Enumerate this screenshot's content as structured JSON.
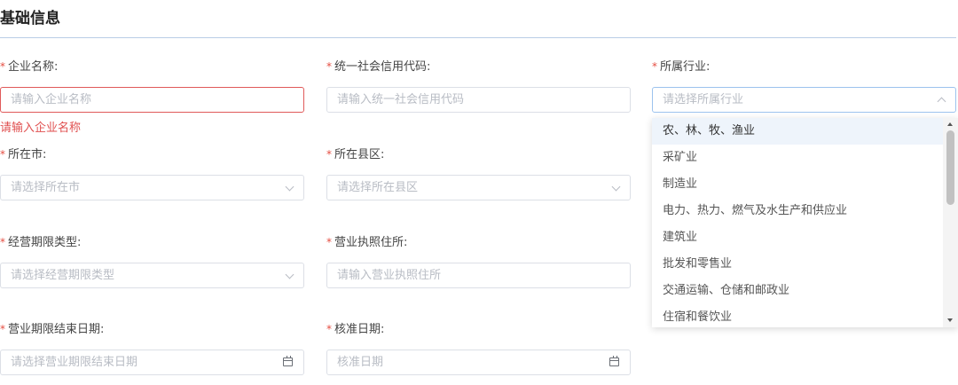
{
  "section_title": "基础信息",
  "company_name": {
    "label": "企业名称:",
    "placeholder": "请输入企业名称",
    "error": "请输入企业名称"
  },
  "credit_code": {
    "label": "统一社会信用代码:",
    "placeholder": "请输入统一社会信用代码"
  },
  "industry": {
    "label": "所属行业:",
    "placeholder": "请选择所属行业",
    "options": [
      "农、林、牧、渔业",
      "采矿业",
      "制造业",
      "电力、热力、燃气及水生产和供应业",
      "建筑业",
      "批发和零售业",
      "交通运输、仓储和邮政业",
      "住宿和餐饮业"
    ]
  },
  "city": {
    "label": "所在市:",
    "placeholder": "请选择所在市"
  },
  "county": {
    "label": "所在县区:",
    "placeholder": "请选择所在县区"
  },
  "term_type": {
    "label": "经营期限类型:",
    "placeholder": "请选择经营期限类型"
  },
  "license_address": {
    "label": "营业执照住所:",
    "placeholder": "请输入营业执照住所"
  },
  "term_end": {
    "label": "营业期限结束日期:",
    "placeholder": "请选择营业期限结束日期"
  },
  "approval_date": {
    "label": "核准日期:",
    "placeholder": "核准日期"
  },
  "required_mark": "*",
  "colors": {
    "required": "#e54d42",
    "error": "#e05050",
    "highlight": "#eef4fb"
  }
}
